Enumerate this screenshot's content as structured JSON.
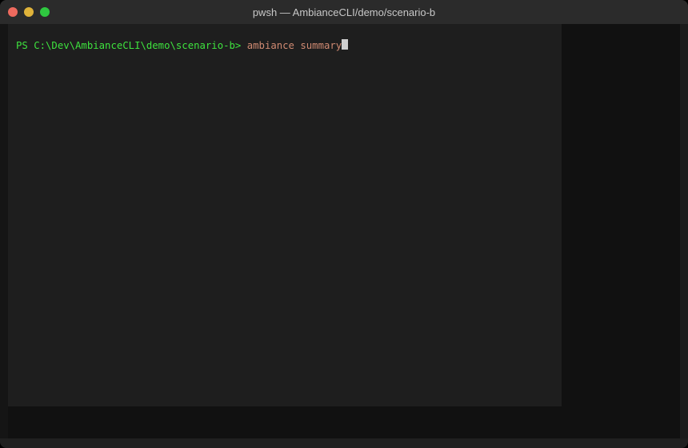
{
  "window": {
    "title": "pwsh — AmbianceCLI/demo/scenario-b"
  },
  "terminal": {
    "prompt": "PS C:\\Dev\\AmbianceCLI\\demo\\scenario-b> ",
    "command": "ambiance summary"
  },
  "colors": {
    "prompt": "#3ee23e",
    "command": "#d08a72",
    "background": "#1e1e1e"
  }
}
